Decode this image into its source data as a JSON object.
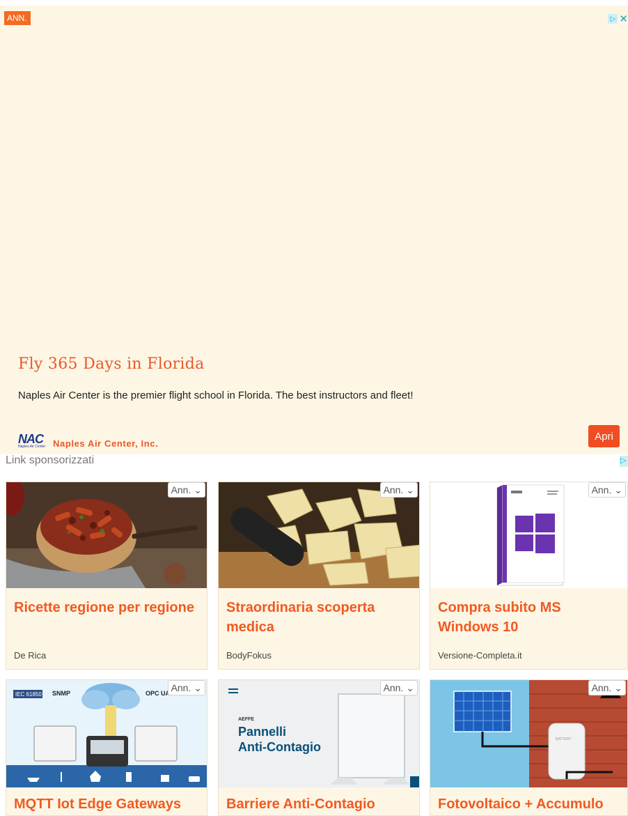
{
  "top_ad": {
    "badge": "ANN.",
    "title": "Fly 365 Days in Florida",
    "description": "Naples Air Center is the premier flight school in Florida. The best instructors and fleet!",
    "logo_text": "NAC",
    "logo_sub": "Naples Air Center",
    "advertiser": "Naples Air Center, Inc.",
    "open_button": "Apri"
  },
  "sponsored": {
    "label": "Link sponsorizzati",
    "cards": [
      {
        "title": "Ricette regione per regione",
        "source": "De Rica",
        "ann": "Ann."
      },
      {
        "title": "Straordinaria scoperta medica",
        "source": "BodyFokus",
        "ann": "Ann."
      },
      {
        "title": "Compra subito MS Windows 10",
        "source": "Versione-Completa.it",
        "ann": "Ann."
      },
      {
        "title": "MQTT Iot Edge Gateways",
        "source": "",
        "ann": "Ann.",
        "image_text": [
          "IEC 61850",
          "SNMP",
          "OPC UA"
        ]
      },
      {
        "title": "Barriere Anti-Contagio",
        "source": "",
        "ann": "Ann.",
        "image_text": [
          "AEFFE",
          "Pannelli",
          "Anti-Contagio"
        ]
      },
      {
        "title": "Fotovoltaico + Accumulo",
        "source": "",
        "ann": "Ann.",
        "image_text": [
          "BATTERY"
        ]
      }
    ]
  },
  "colors": {
    "accent": "#f05a22",
    "ad_background": "#fef6e4",
    "adchoices": "#00aecd"
  }
}
